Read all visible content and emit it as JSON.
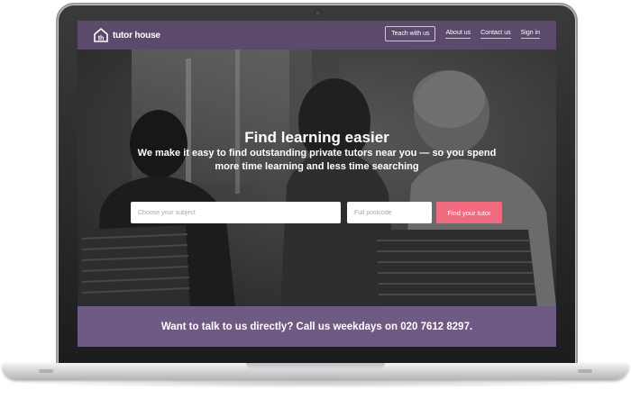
{
  "nav": {
    "logo_text": "tutor house",
    "logo_icon": "th-house-icon",
    "teach_with_us": "Teach with us",
    "about_us": "About us",
    "contact_us": "Contact us",
    "sign_in": "Sign in"
  },
  "hero": {
    "title": "Find learning easier",
    "subtitle": "We make it easy to find outstanding private tutors near you — so you spend more time learning and less time searching"
  },
  "search": {
    "subject_placeholder": "Choose your subject",
    "postcode_placeholder": "Full postcode",
    "button_label": "Find your tutor"
  },
  "footer": {
    "text": "Want to talk to us directly? Call us weekdays on 020 7612 8297."
  },
  "colors": {
    "nav_background": "#5b4a6c",
    "band_background": "#6f5a84",
    "button_accent": "#f06a80"
  }
}
